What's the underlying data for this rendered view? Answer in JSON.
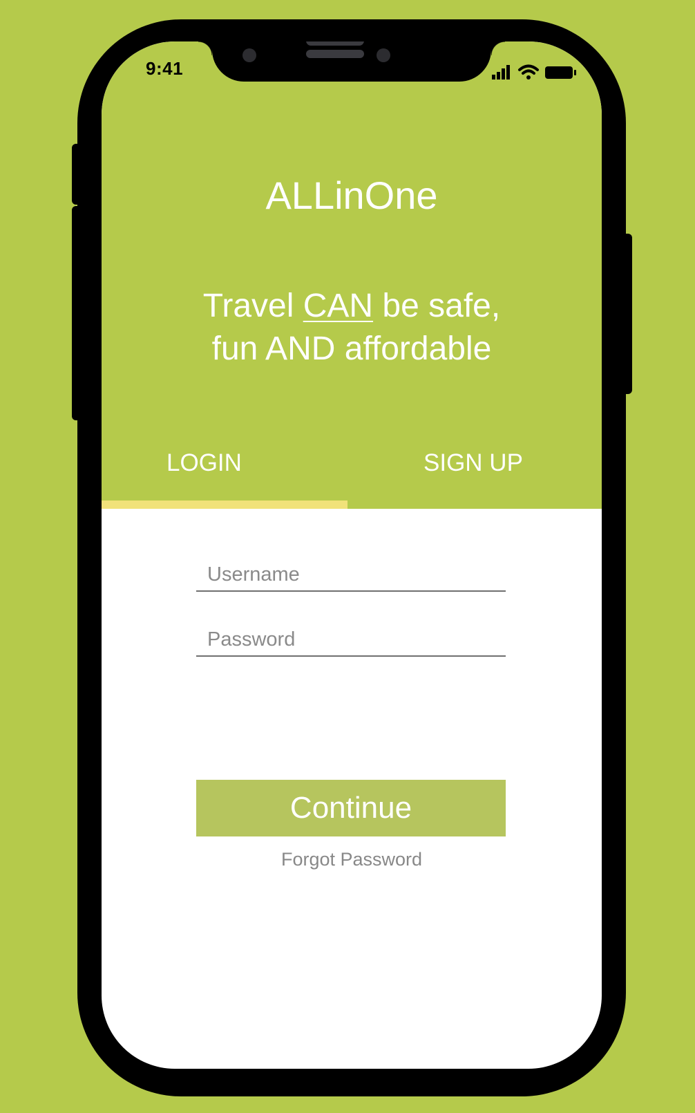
{
  "status_bar": {
    "time": "9:41",
    "icons": [
      "signal-icon",
      "wifi-icon",
      "battery-icon"
    ]
  },
  "app": {
    "title": "ALLinOne"
  },
  "tagline": {
    "part1": "Travel ",
    "emphasis": "CAN",
    "part2": " be safe,",
    "line2": "fun AND affordable"
  },
  "tabs": [
    {
      "label": "LOGIN",
      "active": true
    },
    {
      "label": "SIGN UP",
      "active": false
    }
  ],
  "form": {
    "username_placeholder": "Username",
    "password_placeholder": "Password",
    "continue_label": "Continue",
    "forgot_label": "Forgot Password"
  },
  "colors": {
    "background": "#b5ca4b",
    "header_green": "#b5ca4b",
    "tab_indicator": "#f1e27a",
    "button": "#b6c55e",
    "text_white": "#ffffff"
  }
}
